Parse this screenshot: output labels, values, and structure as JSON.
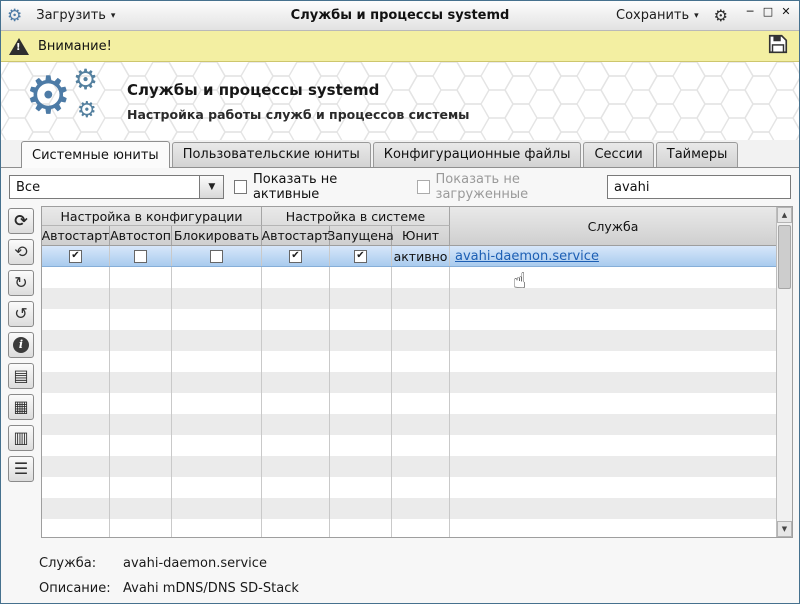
{
  "window": {
    "title": "Службы и процессы systemd",
    "load": "Загрузить",
    "save": "Сохранить"
  },
  "icons": {
    "gear": "⚙",
    "caret_down": "▾",
    "combo_arrow": "▼",
    "scroll_up": "▲",
    "scroll_down": "▼",
    "exclamation": "!",
    "hand": "☝",
    "minimize": "─",
    "maximize": "□",
    "close": "✕"
  },
  "warning": {
    "text": "Внимание!"
  },
  "header": {
    "title": "Службы и процессы systemd",
    "subtitle": "Настройка работы служб и процессов системы"
  },
  "tabs": [
    {
      "label": "Системные юниты",
      "active": true
    },
    {
      "label": "Пользовательские юниты",
      "active": false
    },
    {
      "label": "Конфигурационные файлы",
      "active": false
    },
    {
      "label": "Сессии",
      "active": false
    },
    {
      "label": "Таймеры",
      "active": false
    }
  ],
  "filters": {
    "scope": "Все",
    "show_inactive": "Показать не активные",
    "show_unloaded": "Показать не загруженные",
    "search": "avahi"
  },
  "toolbar": [
    {
      "name": "refresh",
      "glyph": "⟳"
    },
    {
      "name": "reload-daemon",
      "glyph": "⟲"
    },
    {
      "name": "restart-service",
      "glyph": "↻"
    },
    {
      "name": "revert",
      "glyph": "↺"
    },
    {
      "name": "info",
      "glyph": "i"
    },
    {
      "name": "view-unit-file",
      "glyph": "▤"
    },
    {
      "name": "edit-unit-file",
      "glyph": "▦"
    },
    {
      "name": "view-log",
      "glyph": "▥"
    },
    {
      "name": "list-dependencies",
      "glyph": "☰"
    }
  ],
  "table": {
    "groups": {
      "config": "Настройка в конфигурации",
      "system": "Настройка в системе",
      "service": "Служба"
    },
    "columns": [
      "Автостарт",
      "Автостоп",
      "Блокировать",
      "Автостарт",
      "Запущена",
      "Юнит"
    ],
    "rows": [
      {
        "config_autostart": "✔",
        "config_autostop": "",
        "config_block": "",
        "sys_autostart": "✔",
        "sys_running": "✔",
        "unit": "активно",
        "service": "avahi-daemon.service"
      }
    ]
  },
  "details": {
    "service_label": "Служба:",
    "service_value": "avahi-daemon.service",
    "desc_label": "Описание:",
    "desc_value": "Avahi mDNS/DNS SD-Stack"
  }
}
